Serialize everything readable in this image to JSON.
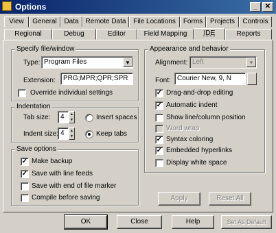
{
  "window": {
    "title": "Options",
    "minimize": "_",
    "close": "✕"
  },
  "tabs_row1": [
    "View",
    "General",
    "Data",
    "Remote Data",
    "File Locations",
    "Forms",
    "Projects",
    "Controls"
  ],
  "tabs_row2": [
    "Regional",
    "Debug",
    "Editor",
    "Field Mapping",
    "IDE",
    "Reports"
  ],
  "active_tab": "IDE",
  "file_group": {
    "title": "Specify file/window",
    "type_label": "Type:",
    "type_value": "Program Files",
    "ext_label": "Extension:",
    "ext_value": "PRG;MPR;QPR;SPR",
    "override_label": "Override individual settings"
  },
  "indent_group": {
    "title": "Indentation",
    "tab_size_label": "Tab size:",
    "tab_size_value": "4",
    "indent_size_label": "Indent size:",
    "indent_size_value": "4",
    "insert_spaces_label": "Insert spaces",
    "keep_tabs_label": "Keep tabs"
  },
  "save_group": {
    "title": "Save options",
    "items": [
      {
        "label": "Make backup",
        "checked": true
      },
      {
        "label": "Save with line feeds",
        "checked": true
      },
      {
        "label": "Save with end of file marker",
        "checked": false
      },
      {
        "label": "Compile before saving",
        "checked": false
      }
    ]
  },
  "appearance_group": {
    "title": "Appearance and behavior",
    "alignment_label": "Alignment:",
    "alignment_value": "Left",
    "font_label": "Font:",
    "font_value": "Courier New, 9, N",
    "items": [
      {
        "label": "Drag-and-drop editing",
        "checked": true,
        "disabled": false
      },
      {
        "label": "Automatic indent",
        "checked": true,
        "disabled": false
      },
      {
        "label": "Show line/column position",
        "checked": false,
        "disabled": false
      },
      {
        "label": "Word wrap",
        "checked": false,
        "disabled": true
      },
      {
        "label": "Syntax coloring",
        "checked": true,
        "disabled": false
      },
      {
        "label": "Embedded hyperlinks",
        "checked": true,
        "disabled": false
      },
      {
        "label": "Display white space",
        "checked": false,
        "disabled": false
      }
    ],
    "apply_label": "Apply",
    "reset_label": "Reset All"
  },
  "footer": {
    "ok_label": "OK",
    "close_label": "Close",
    "help_label": "Help",
    "set_default_label": "Set As Default"
  }
}
